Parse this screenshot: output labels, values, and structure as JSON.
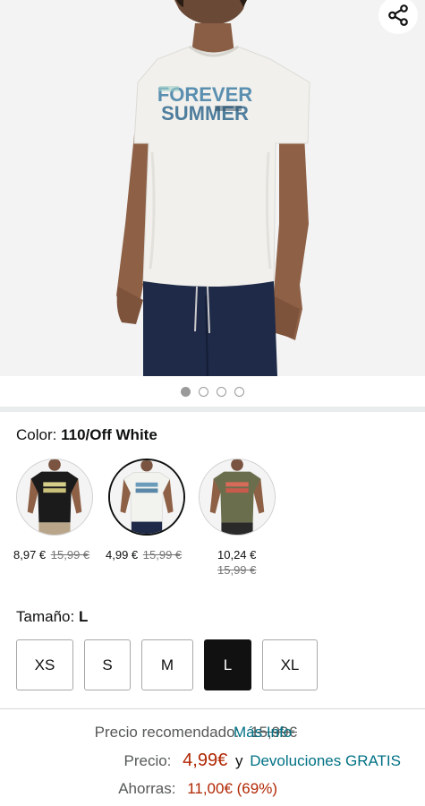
{
  "gallery": {
    "tshirt_text_line1": "FOREVER",
    "tshirt_text_line2": "SUMMER",
    "dots": [
      true,
      false,
      false,
      false
    ]
  },
  "color": {
    "label": "Color:",
    "selected": "110/Off White",
    "options": [
      {
        "price": "8,97 €",
        "list_price": "15,99 €",
        "shirt": "#1b1b1b",
        "selected": false
      },
      {
        "price": "4,99 €",
        "list_price": "15,99 €",
        "shirt": "#f2f2ef",
        "selected": true
      },
      {
        "price": "10,24 €",
        "list_price": "15,99 €",
        "shirt": "#6b6e4d",
        "selected": false
      }
    ]
  },
  "size": {
    "label": "Tamaño:",
    "selected": "L",
    "options": [
      "XS",
      "S",
      "M",
      "L",
      "XL"
    ]
  },
  "pricing": {
    "recommended_label": "Precio recomendado:",
    "recommended_value": "15,99€",
    "more_info": "Más Info",
    "price_label": "Precio:",
    "price_value": "4,99€",
    "and_text": "y",
    "returns_link": "Devoluciones GRATIS",
    "savings_label": "Ahorras:",
    "savings_value": "11,00€ (69%)"
  },
  "colors": {
    "link": "#007185",
    "price": "#b12704",
    "selected_size_bg": "#111111"
  }
}
